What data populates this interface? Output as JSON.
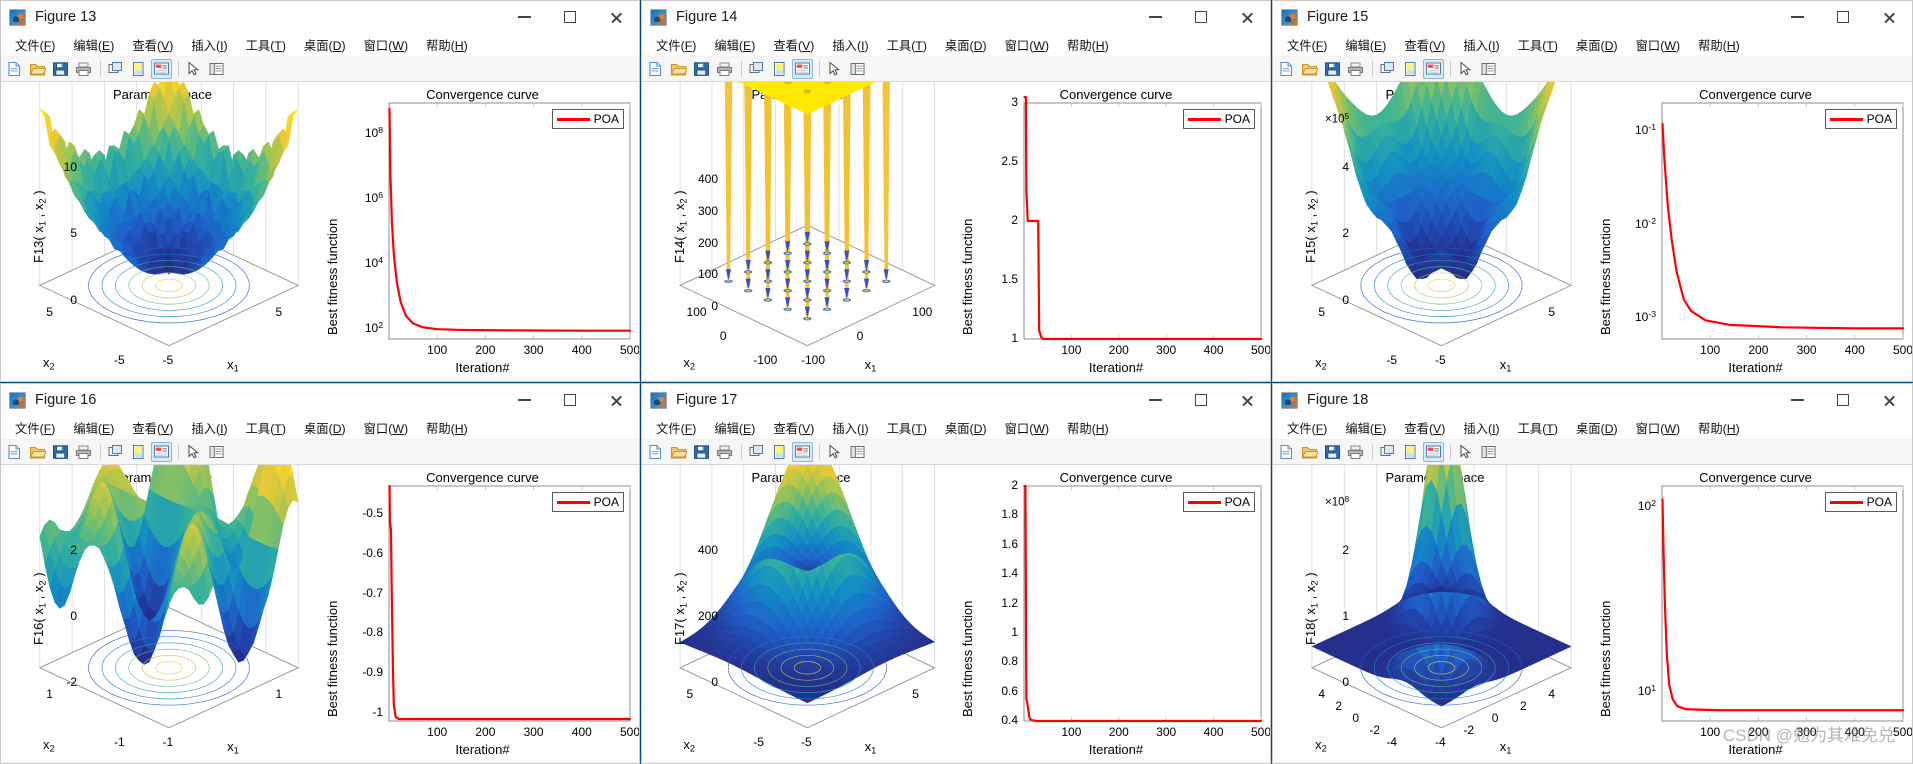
{
  "desktop": {
    "background": "#0c4a7a",
    "watermark": "CSDN @勉为其难免兑"
  },
  "menu": [
    {
      "label": "文件(F)",
      "key": "F"
    },
    {
      "label": "编辑(E)",
      "key": "E"
    },
    {
      "label": "查看(V)",
      "key": "V"
    },
    {
      "label": "插入(I)",
      "key": "I"
    },
    {
      "label": "工具(T)",
      "key": "T"
    },
    {
      "label": "桌面(D)",
      "key": "D"
    },
    {
      "label": "窗口(W)",
      "key": "W"
    },
    {
      "label": "帮助(H)",
      "key": "H"
    }
  ],
  "toolbar_icons": [
    "new-figure-icon",
    "open-file-icon",
    "save-figure-icon",
    "print-figure-icon",
    "link-plot-icon",
    "insert-colorbar-icon",
    "insert-legend-icon",
    "edit-pointer-icon",
    "show-plot-tools-icon"
  ],
  "window_buttons": {
    "minimize": "minimize-button",
    "maximize": "maximize-button",
    "close": "close-button"
  },
  "common": {
    "parameter_space_title": "Parameter space",
    "convergence_title": "Convergence curve",
    "fitness_ylabel": "Best fitness function",
    "iteration_xlabel": "Iteration#",
    "legend_label": "POA",
    "legend_color": "#ff0000",
    "x1_label": "x",
    "x1_sub": "1",
    "x2_label": "x",
    "x2_sub": "2"
  },
  "figures": [
    {
      "title": "Figure 13",
      "surface_zlabel_prefix": "F13",
      "surface": {
        "z_ticks": [
          "10",
          "5",
          "0"
        ],
        "x_ticks": [
          "5",
          "-5"
        ],
        "y_ticks": [
          "-5",
          "5"
        ],
        "exponent": ""
      },
      "chart_data": {
        "type": "line",
        "title": "Convergence curve",
        "xlabel": "Iteration#",
        "ylabel": "Best fitness function",
        "yscale": "log",
        "xlim": [
          0,
          500
        ],
        "ylim": [
          50,
          900000000
        ],
        "xticks": [
          100,
          200,
          300,
          400,
          500
        ],
        "yticks": [
          "10^2",
          "10^4",
          "10^6",
          "10^8"
        ],
        "ytick_labels": [
          "10",
          "10",
          "10",
          "10"
        ],
        "ytick_exponents": [
          "2",
          "4",
          "6",
          "8"
        ],
        "legend": [
          "POA"
        ],
        "series": [
          {
            "name": "POA",
            "x": [
              1,
              3,
              6,
              10,
              16,
              24,
              35,
              50,
              70,
              100,
              150,
              250,
              400,
              500
            ],
            "y": [
              600000000,
              5000000,
              200000,
              20000,
              3000,
              700,
              260,
              150,
              115,
              100,
              95,
              92,
              90,
              90
            ]
          }
        ]
      }
    },
    {
      "title": "Figure 14",
      "surface_zlabel_prefix": "F14",
      "surface": {
        "z_ticks": [
          "400",
          "300",
          "200",
          "100",
          "0"
        ],
        "x_ticks": [
          "100",
          "0",
          "-100"
        ],
        "y_ticks": [
          "-100",
          "0",
          "100"
        ],
        "exponent": ""
      },
      "chart_data": {
        "type": "line",
        "title": "Convergence curve",
        "xlabel": "Iteration#",
        "ylabel": "Best fitness function",
        "yscale": "linear",
        "xlim": [
          0,
          500
        ],
        "ylim": [
          1,
          3
        ],
        "xticks": [
          100,
          200,
          300,
          400,
          500
        ],
        "yticks": [
          1,
          1.5,
          2,
          2.5,
          3
        ],
        "ytick_labels": [
          "1",
          "1.5",
          "2",
          "2.5",
          "3"
        ],
        "legend": [
          "POA"
        ],
        "series": [
          {
            "name": "POA",
            "x": [
              1,
              4,
              5,
              8,
              30,
              32,
              36,
              40,
              42,
              500
            ],
            "y": [
              3.05,
              3.05,
              2.25,
              2.0,
              2.0,
              1.07,
              1.02,
              1.0,
              1.0,
              1.0
            ]
          }
        ]
      }
    },
    {
      "title": "Figure 15",
      "surface_zlabel_prefix": "F15",
      "surface": {
        "z_ticks": [
          "4",
          "2",
          "0"
        ],
        "x_ticks": [
          "5",
          "-5"
        ],
        "y_ticks": [
          "-5",
          "5"
        ],
        "exponent": "×10",
        "exponent_sup": "5"
      },
      "chart_data": {
        "type": "line",
        "title": "Convergence curve",
        "xlabel": "Iteration#",
        "ylabel": "Best fitness function",
        "yscale": "log",
        "xlim": [
          0,
          500
        ],
        "ylim": [
          0.0006,
          0.2
        ],
        "xticks": [
          100,
          200,
          300,
          400,
          500
        ],
        "ytick_labels": [
          "10",
          "10",
          "10"
        ],
        "ytick_exponents": [
          "-3",
          "-2",
          "-1"
        ],
        "legend": [
          "POA"
        ],
        "series": [
          {
            "name": "POA",
            "x": [
              1,
              5,
              12,
              20,
              30,
              45,
              60,
              90,
              140,
              250,
              400,
              500
            ],
            "y": [
              0.12,
              0.05,
              0.016,
              0.007,
              0.0032,
              0.0016,
              0.0012,
              0.00095,
              0.00085,
              0.0008,
              0.00078,
              0.00078
            ]
          }
        ]
      }
    },
    {
      "title": "Figure 16",
      "surface_zlabel_prefix": "F16",
      "surface": {
        "z_ticks": [
          "2",
          "0",
          "-2"
        ],
        "x_ticks": [
          "1",
          "-1"
        ],
        "y_ticks": [
          "-1",
          "1"
        ],
        "exponent": ""
      },
      "chart_data": {
        "type": "line",
        "title": "Convergence curve",
        "xlabel": "Iteration#",
        "ylabel": "Best fitness function",
        "yscale": "linear",
        "xlim": [
          0,
          500
        ],
        "ylim": [
          -1.02,
          -0.43
        ],
        "xticks": [
          100,
          200,
          300,
          400,
          500
        ],
        "yticks": [
          -1,
          -0.9,
          -0.8,
          -0.7,
          -0.6,
          -0.5
        ],
        "ytick_labels": [
          "-1",
          "-0.9",
          "-0.8",
          "-0.7",
          "-0.6",
          "-0.5"
        ],
        "legend": [
          "POA"
        ],
        "series": [
          {
            "name": "POA",
            "x": [
              1,
              2,
              4,
              6,
              8,
              10,
              14,
              20,
              500
            ],
            "y": [
              -0.43,
              -0.52,
              -0.54,
              -0.72,
              -0.88,
              -0.98,
              -1.01,
              -1.015,
              -1.015
            ]
          }
        ]
      }
    },
    {
      "title": "Figure 17",
      "surface_zlabel_prefix": "F17",
      "surface": {
        "z_ticks": [
          "400",
          "200",
          "0"
        ],
        "x_ticks": [
          "5",
          "-5"
        ],
        "y_ticks": [
          "-5",
          "5"
        ],
        "exponent": ""
      },
      "chart_data": {
        "type": "line",
        "title": "Convergence curve",
        "xlabel": "Iteration#",
        "ylabel": "Best fitness function",
        "yscale": "linear",
        "xlim": [
          0,
          500
        ],
        "ylim": [
          0.4,
          2.0
        ],
        "xticks": [
          100,
          200,
          300,
          400,
          500
        ],
        "yticks": [
          0.4,
          0.6,
          0.8,
          1,
          1.2,
          1.4,
          1.6,
          1.8,
          2
        ],
        "ytick_labels": [
          "0.4",
          "0.6",
          "0.8",
          "1",
          "1.2",
          "1.4",
          "1.6",
          "1.8",
          "2"
        ],
        "legend": [
          "POA"
        ],
        "series": [
          {
            "name": "POA",
            "x": [
              1,
              3,
              5,
              7,
              9,
              11,
              14,
              18,
              25,
              500
            ],
            "y": [
              2.0,
              2.0,
              0.55,
              0.52,
              0.48,
              0.43,
              0.41,
              0.405,
              0.4,
              0.4
            ]
          }
        ]
      }
    },
    {
      "title": "Figure 18",
      "surface_zlabel_prefix": "F18",
      "surface": {
        "z_ticks": [
          "2",
          "1",
          "0"
        ],
        "x_ticks": [
          "4",
          "2",
          "0",
          "-2",
          "-4"
        ],
        "y_ticks": [
          "-4",
          "-2",
          "0",
          "2",
          "4"
        ],
        "exponent": "×10",
        "exponent_sup": "8"
      },
      "chart_data": {
        "type": "line",
        "title": "Convergence curve",
        "xlabel": "Iteration#",
        "ylabel": "Best fitness function",
        "yscale": "log",
        "xlim": [
          0,
          500
        ],
        "ylim": [
          7,
          130
        ],
        "xticks": [
          100,
          200,
          300,
          400,
          500
        ],
        "ytick_labels": [
          "10",
          "10"
        ],
        "ytick_exponents": [
          "1",
          "2"
        ],
        "legend": [
          "POA"
        ],
        "series": [
          {
            "name": "POA",
            "x": [
              1,
              3,
              6,
              10,
              15,
              22,
              32,
              50,
              120,
              300,
              500
            ],
            "y": [
              110,
              60,
              30,
              16,
              11,
              9.2,
              8.4,
              8.1,
              8.0,
              8.0,
              8.0
            ]
          }
        ]
      }
    }
  ]
}
